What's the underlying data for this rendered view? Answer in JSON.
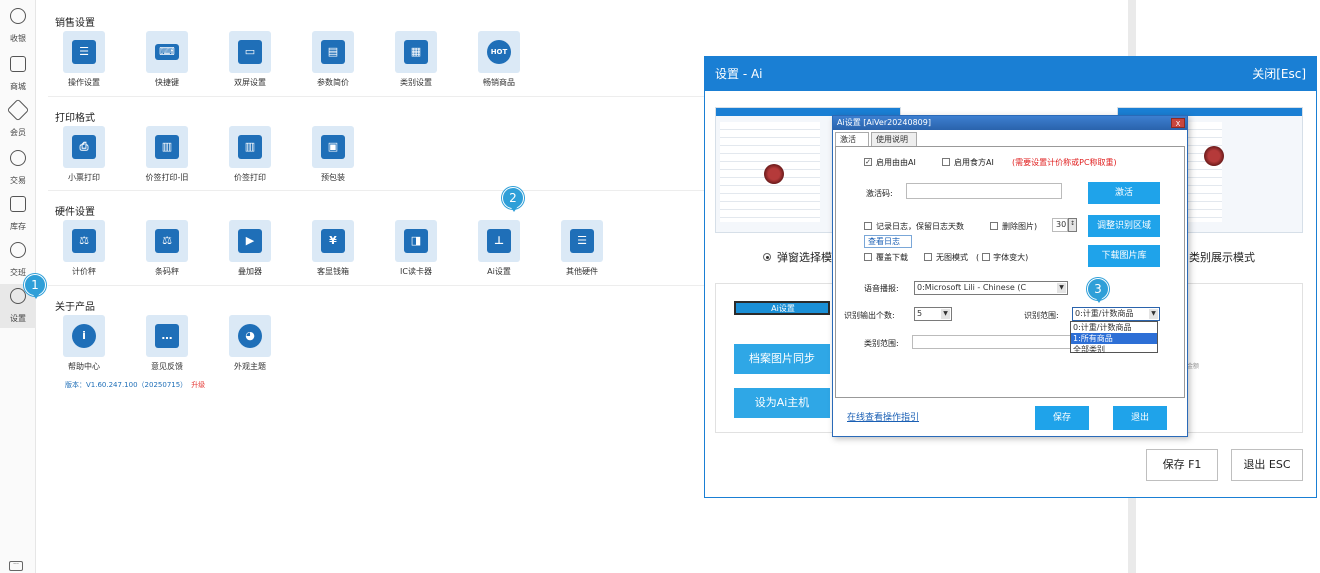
{
  "nav": {
    "items": [
      {
        "label": "收银"
      },
      {
        "label": "商城"
      },
      {
        "label": "会员"
      },
      {
        "label": "交易"
      },
      {
        "label": "库存"
      },
      {
        "label": "交班"
      },
      {
        "label": "设置"
      }
    ],
    "more_icon": "···"
  },
  "sections": {
    "sales": {
      "title": "销售设置",
      "items": [
        "操作设置",
        "快捷键",
        "双屏设置",
        "参数简价",
        "类别设置",
        "畅销商品"
      ]
    },
    "print": {
      "title": "打印格式",
      "items": [
        "小票打印",
        "价签打印-旧",
        "价签打印",
        "预包装"
      ]
    },
    "hardware": {
      "title": "硬件设置",
      "items": [
        "计价秤",
        "条码秤",
        "叠加器",
        "客显钱箱",
        "IC读卡器",
        "Ai设置",
        "其他硬件"
      ]
    },
    "about": {
      "title": "关于产品",
      "items": [
        "帮助中心",
        "意见反馈",
        "外观主题"
      ]
    }
  },
  "version": {
    "text": "版本：V1.60.247.100（20250715）",
    "upgrade": "升级"
  },
  "badges": [
    "1",
    "2",
    "3"
  ],
  "hot_label": "HOT",
  "yen": "¥",
  "info_i": "i",
  "settings_ai": {
    "title": "设置 - Ai",
    "close": "关闭[Esc]",
    "mode_left": "弹窗选择模",
    "mode_right": "类别展示模式",
    "buttons": [
      "Ai设置",
      "档案图片同步",
      "设为Ai主机"
    ],
    "tiny_text": "小计金额",
    "save": "保存 F1",
    "exit": "退出 ESC"
  },
  "dialog": {
    "title": "Ai设置 [AiVer20240809]",
    "close": "X",
    "tabs": [
      "激活",
      "使用说明"
    ],
    "enable_youyou": "启用由由AI",
    "enable_shifang": "启用食方AI",
    "warning": "(需要设置计价称或PC称取重)",
    "activation_code_label": "激活码:",
    "activate_btn": "激活",
    "log_label": "记录日志，保留日志天数",
    "delete_img_label": "删除图片)",
    "days_value": "30",
    "view_log": "查看日志",
    "adjust_region": "调整识别区域",
    "overwrite_download": "覆盖下载",
    "no_img_mode": "无图模式",
    "font_larger": "字体变大)",
    "download_lib": "下载图片库",
    "voice_label": "语音播报:",
    "voice_value": "0:Microsoft Lili - Chinese (C",
    "output_count_label": "识别输出个数:",
    "output_count_value": "5",
    "range_label": "识别范围:",
    "range_value": "0:计重/计数商品",
    "category_label": "类别范围:",
    "range_options": [
      "0:计重/计数商品",
      "1:所有商品",
      "全部类别"
    ],
    "guide_link": "在线查看操作指引",
    "save": "保存",
    "exit": "退出"
  }
}
